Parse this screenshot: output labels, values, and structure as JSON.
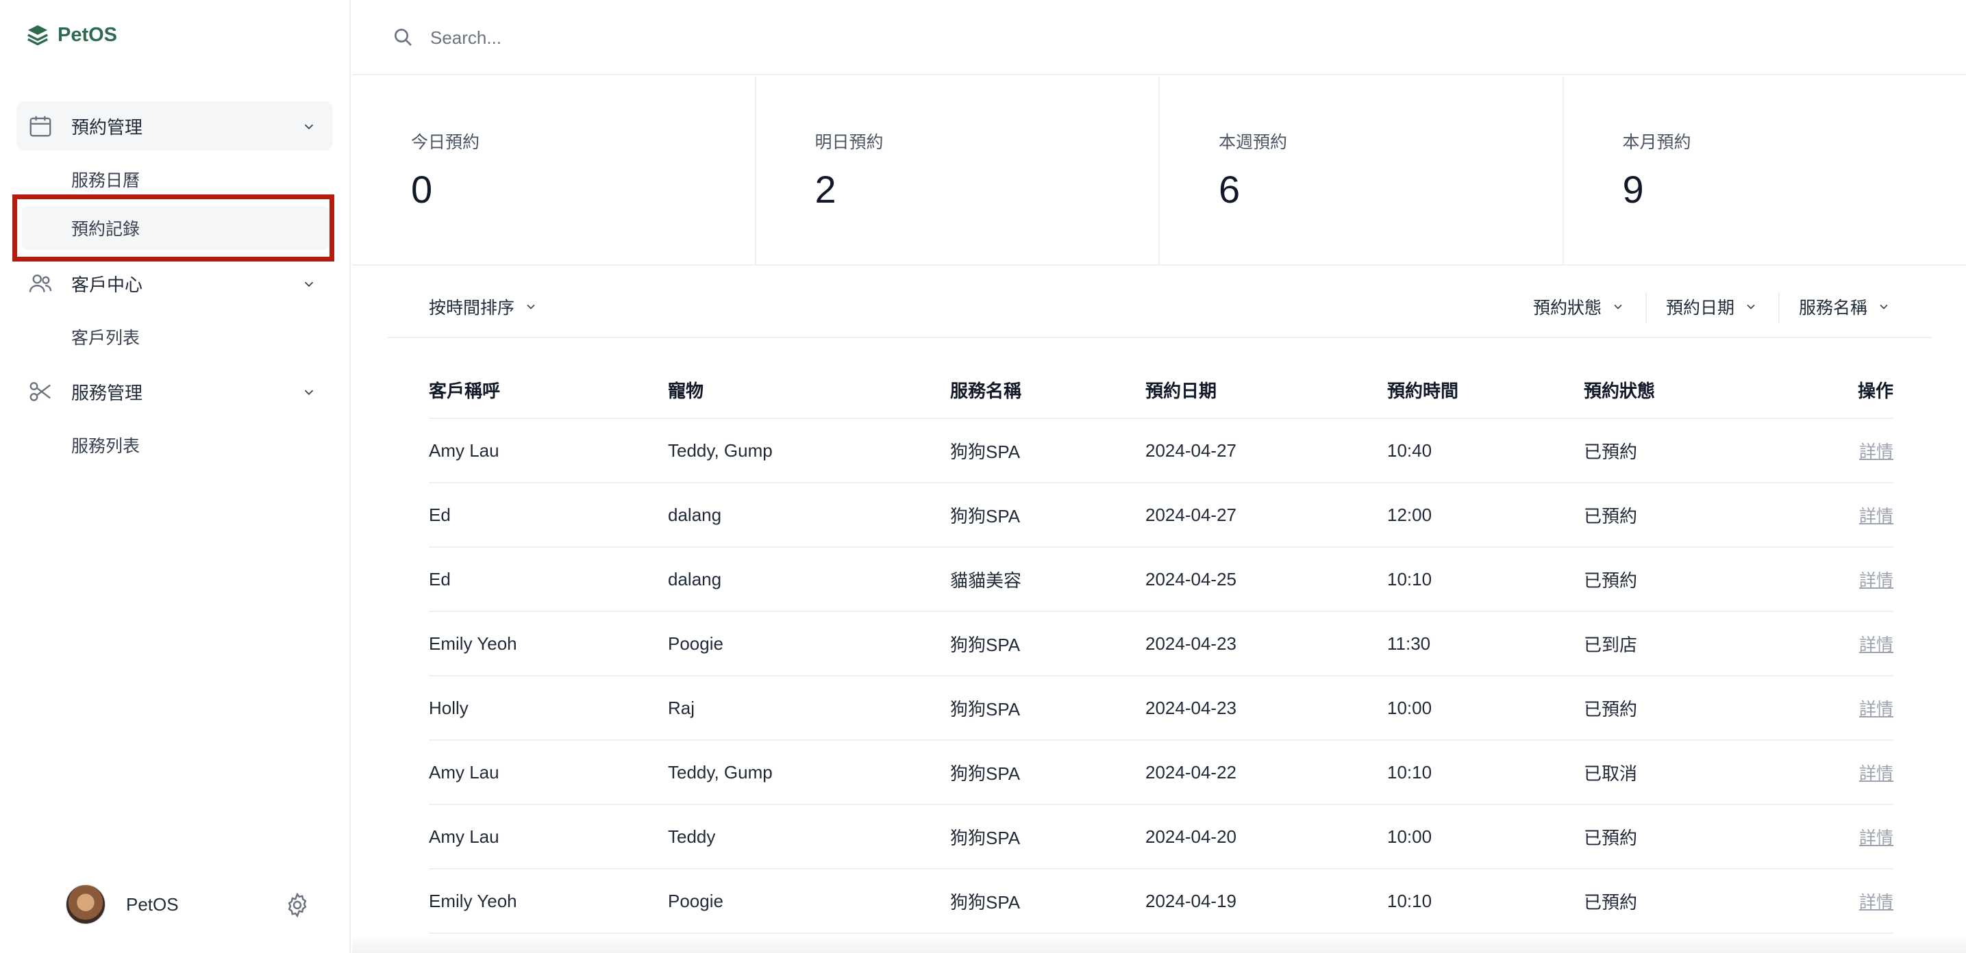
{
  "brand": {
    "name": "PetOS"
  },
  "sidebar": {
    "groups": [
      {
        "label": "預約管理",
        "icon": "calendar-icon",
        "items": [
          "服務日曆",
          "預約記錄"
        ]
      },
      {
        "label": "客戶中心",
        "icon": "users-icon",
        "items": [
          "客戶列表"
        ]
      },
      {
        "label": "服務管理",
        "icon": "scissors-icon",
        "items": [
          "服務列表"
        ]
      }
    ],
    "active_item": "預約記錄",
    "user": {
      "name": "PetOS"
    }
  },
  "search": {
    "placeholder": "Search..."
  },
  "stats": [
    {
      "label": "今日預約",
      "value": "0"
    },
    {
      "label": "明日預約",
      "value": "2"
    },
    {
      "label": "本週預約",
      "value": "6"
    },
    {
      "label": "本月預約",
      "value": "9"
    }
  ],
  "filters": {
    "sort": "按時間排序",
    "status": "預約狀態",
    "date": "預約日期",
    "service": "服務名稱"
  },
  "table": {
    "headers": [
      "客戶稱呼",
      "寵物",
      "服務名稱",
      "預約日期",
      "預約時間",
      "預約狀態",
      "操作"
    ],
    "rows": [
      [
        "Amy Lau",
        "Teddy, Gump",
        "狗狗SPA",
        "2024-04-27",
        "10:40",
        "已預約",
        "詳情"
      ],
      [
        "Ed",
        "dalang",
        "狗狗SPA",
        "2024-04-27",
        "12:00",
        "已預約",
        "詳情"
      ],
      [
        "Ed",
        "dalang",
        "貓貓美容",
        "2024-04-25",
        "10:10",
        "已預約",
        "詳情"
      ],
      [
        "Emily Yeoh",
        "Poogie",
        "狗狗SPA",
        "2024-04-23",
        "11:30",
        "已到店",
        "詳情"
      ],
      [
        "Holly",
        "Raj",
        "狗狗SPA",
        "2024-04-23",
        "10:00",
        "已預約",
        "詳情"
      ],
      [
        "Amy Lau",
        "Teddy, Gump",
        "狗狗SPA",
        "2024-04-22",
        "10:10",
        "已取消",
        "詳情"
      ],
      [
        "Amy Lau",
        "Teddy",
        "狗狗SPA",
        "2024-04-20",
        "10:00",
        "已預約",
        "詳情"
      ],
      [
        "Emily Yeoh",
        "Poogie",
        "狗狗SPA",
        "2024-04-19",
        "10:10",
        "已預約",
        "詳情"
      ]
    ]
  },
  "colors": {
    "brand": "#2d6a4f",
    "highlight": "#b51c0e",
    "border": "#eef0f2",
    "muted_link": "#9ca3af"
  }
}
